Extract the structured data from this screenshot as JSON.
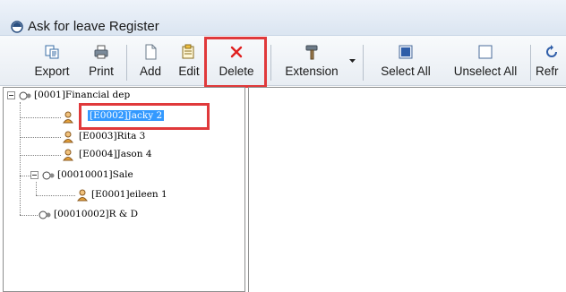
{
  "window": {
    "title": "Ask for leave Register"
  },
  "toolbar": {
    "export_label": "Export",
    "print_label": "Print",
    "add_label": "Add",
    "edit_label": "Edit",
    "delete_label": "Delete",
    "extension_label": "Extension",
    "select_all_label": "Select All",
    "unselect_all_label": "Unselect All",
    "refresh_label": "Refr"
  },
  "tree": {
    "root": "[0001]Financial dep",
    "emp_jacky": "[E0002]Jacky  2",
    "emp_rita": "[E0003]Rita  3",
    "emp_jason": "[E0004]Jason  4",
    "sale": "[00010001]Sale",
    "emp_eileen": "[E0001]eileen  1",
    "rnd": "[00010002]R & D"
  },
  "colors": {
    "highlight": "#e0393b",
    "selection": "#3399ff",
    "delete_icon": "#e02020"
  }
}
